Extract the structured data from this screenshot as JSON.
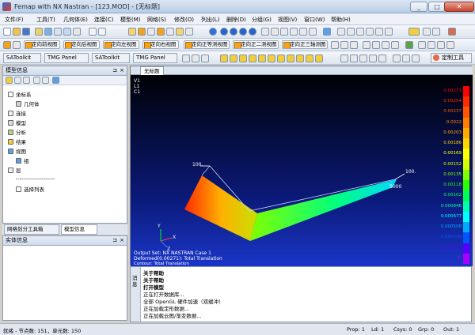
{
  "window": {
    "title": "Femap with NX Nastran - [123.MOD] - [无标题]",
    "min": "_",
    "max": "□",
    "close": "✕"
  },
  "menu": [
    "文件(F)",
    "工具(T)",
    "几何体(E)",
    "连接(C)",
    "模型(M)",
    "网格(S)",
    "修改(O)",
    "列出(L)",
    "删除(D)",
    "分组(G)",
    "视图(V)",
    "窗口(W)",
    "帮助(H)"
  ],
  "view_toolbar": [
    "定向前视图",
    "定向后视图",
    "定向左视图",
    "定向右视图",
    "定向正等测视图",
    "定向正二测视图",
    "定向正三轴测图"
  ],
  "panel_tabs_top": [
    "SAToolkit",
    "TMG Panel",
    "SAToolkit",
    "TMG Panel"
  ],
  "custom_tools": "定制工具",
  "model_info": {
    "title": "模型信息",
    "pin": "⊐",
    "close": "×",
    "items": [
      {
        "label": "坐标系",
        "icon": "coordinate-icon"
      },
      {
        "label": "几何体",
        "icon": "geometry-icon"
      },
      {
        "label": "连接",
        "icon": "connection-icon"
      },
      {
        "label": "模型",
        "icon": "model-icon"
      },
      {
        "label": "分析",
        "icon": "analysis-icon"
      },
      {
        "label": "结果",
        "icon": "results-icon"
      },
      {
        "label": "视图",
        "icon": "view-icon"
      },
      {
        "label": "组",
        "icon": "group-icon"
      },
      {
        "label": "层",
        "icon": "layer-icon"
      }
    ],
    "separator": "---------------------",
    "select_list": "选择列表"
  },
  "bottom_tabs": [
    "网格划分工具箱",
    "模型信息"
  ],
  "entity_info": {
    "title": "实体信息",
    "pin": "⊐",
    "close": "×"
  },
  "graphics": {
    "tab": "无标题",
    "corner": [
      "V1",
      "L1",
      "C1"
    ],
    "labels": {
      "load1": "100.",
      "load2": "100.",
      "node": "5000"
    },
    "output": [
      "Output Set: NX NASTRAN Case 1",
      "Deformed(0.00271): Total Translation",
      "Contour: Total Translation"
    ],
    "axis_labels": {
      "x": "X",
      "y": "Y",
      "z": "Z"
    },
    "legend": [
      "0.00271",
      "0.00254",
      "0.00237",
      "0.0022",
      "0.00203",
      "0.00186",
      "0.00169",
      "0.00152",
      "0.00135",
      "0.00118",
      "0.00102",
      "0.000846",
      "0.000677",
      "0.000508",
      "0.000339",
      "0.000169",
      "0."
    ],
    "legend_colors": [
      "#ff0000",
      "#ff2a00",
      "#ff5500",
      "#ff8000",
      "#ffaa00",
      "#ffd400",
      "#ffff00",
      "#d4ff00",
      "#80ff00",
      "#2aff00",
      "#00ff55",
      "#00ffaa",
      "#00ffff",
      "#00aaff",
      "#0055ff",
      "#5500ff",
      "#aa00ff"
    ]
  },
  "messages": {
    "side_label": "消息",
    "lines": [
      "关于帮助",
      "关于帮助",
      "打开模型",
      "正在打开数据库...",
      "全部 OpenGL 硬件加速（双缓冲）",
      "正在加载定形数据...",
      "正在加载云图/渐变数据..."
    ]
  },
  "status": {
    "main": "就绪 - 节点数: 151，单元数: 150",
    "prop": "Prop: 1",
    "ld": "Ld: 1",
    "csys": "Csys: 0",
    "grp": "Grp: 0",
    "out": "Out: 1"
  }
}
